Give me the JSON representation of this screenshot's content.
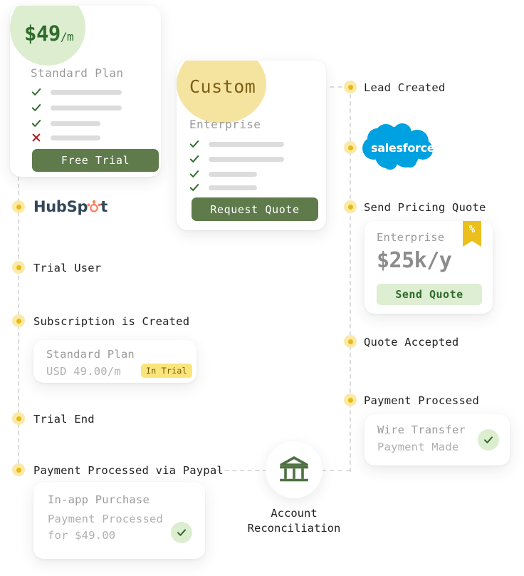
{
  "colors": {
    "brand_green": "#5f7a4b",
    "light_green": "#dcedd0",
    "dark_green": "#2f6b2c",
    "yellow": "#f5e4a0",
    "gold": "#e8b912",
    "hubspot_navy": "#33475b",
    "hubspot_orange": "#ff7a59",
    "salesforce_blue": "#00a1e0",
    "muted_text": "#9b9b9b",
    "dash_line": "#dcdcdc"
  },
  "pricing_cards": [
    {
      "id": "standard",
      "badge_value": "$49",
      "badge_period": "/m",
      "plan_name": "Standard Plan",
      "features": [
        {
          "icon": "check-icon",
          "included": true
        },
        {
          "icon": "check-icon",
          "included": true
        },
        {
          "icon": "check-icon",
          "included": true
        },
        {
          "icon": "cross-icon",
          "included": false
        }
      ],
      "cta_label": "Free Trial"
    },
    {
      "id": "enterprise",
      "badge_value": "Custom",
      "plan_name": "Enterprise",
      "features": [
        {
          "icon": "check-icon",
          "included": true
        },
        {
          "icon": "check-icon",
          "included": true
        },
        {
          "icon": "check-icon",
          "included": true
        },
        {
          "icon": "check-icon",
          "included": true
        }
      ],
      "cta_label": "Request Quote"
    }
  ],
  "left_track": {
    "logo": {
      "name": "hubspot-logo",
      "text_a": "HubSp",
      "text_b": "t"
    },
    "steps": [
      {
        "label": "Trial User"
      },
      {
        "label": "Subscription is Created"
      },
      {
        "label": "Trial End"
      },
      {
        "label": "Payment Processed via Paypal"
      }
    ],
    "subscription_card": {
      "title": "Standard Plan",
      "subtitle": "USD 49.00/m",
      "badge": "In Trial"
    },
    "purchase_card": {
      "title": "In-app Purchase",
      "line1": "Payment Processed",
      "line2": "for $49.00",
      "status_icon": "check-icon"
    }
  },
  "right_track": {
    "logo": {
      "name": "salesforce-logo",
      "text": "salesforce"
    },
    "steps": [
      {
        "label": "Lead Created"
      },
      {
        "label": "Send Pricing Quote"
      },
      {
        "label": "Quote Accepted"
      },
      {
        "label": "Payment Processed"
      }
    ],
    "quote_card": {
      "title": "Enterprise",
      "price": "$25k/y",
      "cta_label": "Send Quote",
      "ribbon_symbol": "%"
    },
    "wire_card": {
      "title": "Wire Transfer",
      "subtitle": "Payment Made",
      "status_icon": "check-icon"
    }
  },
  "center_node": {
    "icon": "bank-icon",
    "label_line1": "Account",
    "label_line2": "Reconciliation"
  }
}
